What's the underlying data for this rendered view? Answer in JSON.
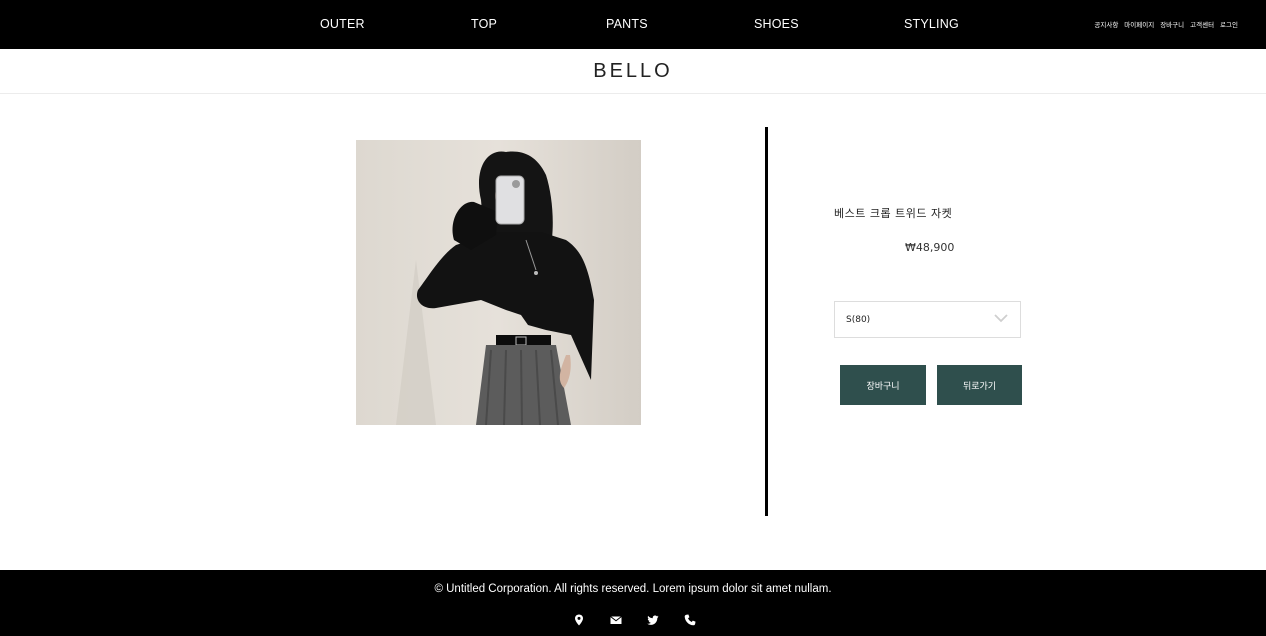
{
  "nav": {
    "items": [
      {
        "label": "OUTER"
      },
      {
        "label": "TOP"
      },
      {
        "label": "PANTS"
      },
      {
        "label": "SHOES"
      },
      {
        "label": "STYLING"
      }
    ],
    "utility": [
      {
        "label": "공지사항"
      },
      {
        "label": "마이페이지"
      },
      {
        "label": "장바구니"
      },
      {
        "label": "고객센터"
      },
      {
        "label": "로그인"
      }
    ]
  },
  "brand": {
    "logo": "BELLO"
  },
  "product": {
    "image_icon": "product-photo-cropped-tweed-jacket",
    "name": "베스트 크롭 트위드 자켓",
    "price": "₩48,900",
    "size_selected": "S(80)",
    "cart_button": "장바구니",
    "back_button": "뒤로가기"
  },
  "footer": {
    "copyright": "© Untitled Corporation. All rights reserved. Lorem ipsum dolor sit amet nullam.",
    "icons": [
      "map-marker-icon",
      "envelope-icon",
      "twitter-icon",
      "phone-icon"
    ]
  },
  "colors": {
    "nav_bg": "#000000",
    "button_bg": "#2f4f4d",
    "footer_bg": "#000000"
  }
}
